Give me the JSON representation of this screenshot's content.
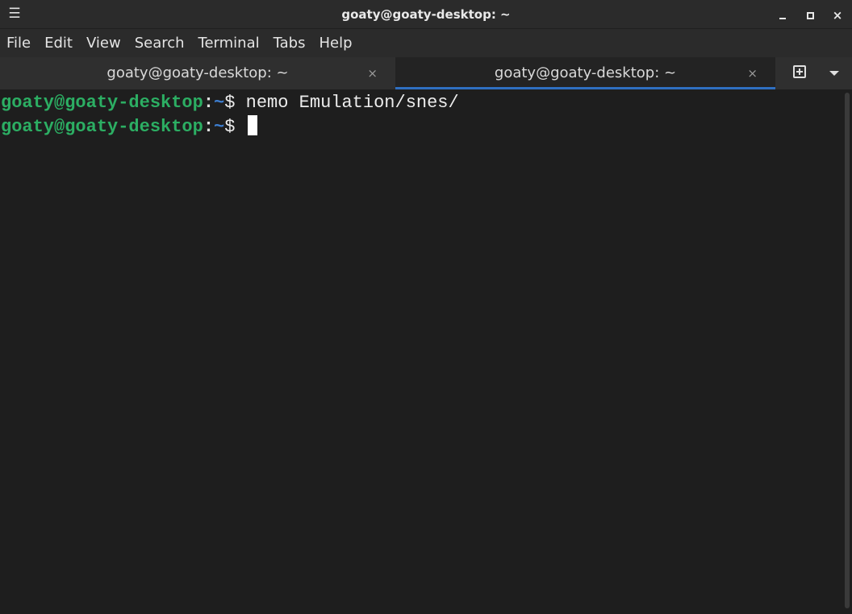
{
  "window": {
    "title": "goaty@goaty-desktop: ~",
    "menu_icon": "hamburger-icon",
    "controls": [
      "minimize-icon",
      "maximize-icon",
      "close-icon"
    ]
  },
  "menubar": {
    "items": [
      "File",
      "Edit",
      "View",
      "Search",
      "Terminal",
      "Tabs",
      "Help"
    ]
  },
  "tabs": [
    {
      "label": "goaty@goaty-desktop: ~",
      "active": false,
      "close": "×"
    },
    {
      "label": "goaty@goaty-desktop: ~",
      "active": true,
      "close": "×"
    }
  ],
  "tabbar_actions": {
    "new_tab_icon": "new-tab-icon",
    "dropdown_icon": "chevron-down-icon"
  },
  "terminal": {
    "lines": [
      {
        "user": "goaty@goaty-desktop",
        "colon": ":",
        "path": "~",
        "dollar": "$ ",
        "command": "nemo Emulation/snes/"
      },
      {
        "user": "goaty@goaty-desktop",
        "colon": ":",
        "path": "~",
        "dollar": "$ ",
        "command": ""
      }
    ]
  },
  "colors": {
    "accent": "#2f6fc1",
    "prompt_user": "#2cae63",
    "prompt_path": "#3d7fd2",
    "background": "#1e1e1e"
  }
}
